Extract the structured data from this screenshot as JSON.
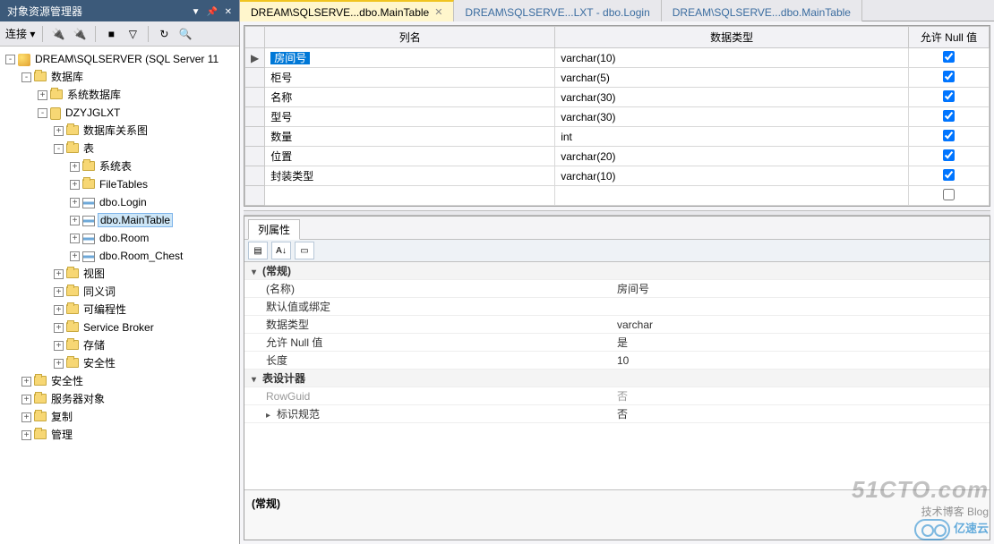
{
  "panel": {
    "title": "对象资源管理器",
    "connect_label": "连接 ▾"
  },
  "tree": [
    {
      "indent": 0,
      "exp": "-",
      "icon": "srv",
      "label": "DREAM\\SQLSERVER (SQL Server 11"
    },
    {
      "indent": 1,
      "exp": "-",
      "icon": "folder",
      "label": "数据库"
    },
    {
      "indent": 2,
      "exp": "+",
      "icon": "folder",
      "label": "系统数据库"
    },
    {
      "indent": 2,
      "exp": "-",
      "icon": "db",
      "label": "DZYJGLXT"
    },
    {
      "indent": 3,
      "exp": "+",
      "icon": "folder",
      "label": "数据库关系图"
    },
    {
      "indent": 3,
      "exp": "-",
      "icon": "folder",
      "label": "表"
    },
    {
      "indent": 4,
      "exp": "+",
      "icon": "folder",
      "label": "系统表"
    },
    {
      "indent": 4,
      "exp": "+",
      "icon": "folder",
      "label": "FileTables"
    },
    {
      "indent": 4,
      "exp": "+",
      "icon": "tbl",
      "label": "dbo.Login"
    },
    {
      "indent": 4,
      "exp": "+",
      "icon": "tbl",
      "label": "dbo.MainTable",
      "selected": true
    },
    {
      "indent": 4,
      "exp": "+",
      "icon": "tbl",
      "label": "dbo.Room"
    },
    {
      "indent": 4,
      "exp": "+",
      "icon": "tbl",
      "label": "dbo.Room_Chest"
    },
    {
      "indent": 3,
      "exp": "+",
      "icon": "folder",
      "label": "视图"
    },
    {
      "indent": 3,
      "exp": "+",
      "icon": "folder",
      "label": "同义词"
    },
    {
      "indent": 3,
      "exp": "+",
      "icon": "folder",
      "label": "可编程性"
    },
    {
      "indent": 3,
      "exp": "+",
      "icon": "folder",
      "label": "Service Broker"
    },
    {
      "indent": 3,
      "exp": "+",
      "icon": "folder",
      "label": "存储"
    },
    {
      "indent": 3,
      "exp": "+",
      "icon": "folder",
      "label": "安全性"
    },
    {
      "indent": 1,
      "exp": "+",
      "icon": "folder",
      "label": "安全性"
    },
    {
      "indent": 1,
      "exp": "+",
      "icon": "folder",
      "label": "服务器对象"
    },
    {
      "indent": 1,
      "exp": "+",
      "icon": "folder",
      "label": "复制"
    },
    {
      "indent": 1,
      "exp": "+",
      "icon": "folder",
      "label": "管理"
    }
  ],
  "tabs": [
    {
      "label": "DREAM\\SQLSERVE...dbo.MainTable",
      "active": true,
      "closable": true
    },
    {
      "label": "DREAM\\SQLSERVE...LXT - dbo.Login",
      "active": false
    },
    {
      "label": "DREAM\\SQLSERVE...dbo.MainTable",
      "active": false
    }
  ],
  "designer": {
    "headers": {
      "col": "列名",
      "type": "数据类型",
      "null": "允许 Null 值"
    },
    "rows": [
      {
        "name": "房间号",
        "type": "varchar(10)",
        "nullable": true,
        "current": true
      },
      {
        "name": "柜号",
        "type": "varchar(5)",
        "nullable": true
      },
      {
        "name": "名称",
        "type": "varchar(30)",
        "nullable": true
      },
      {
        "name": "型号",
        "type": "varchar(30)",
        "nullable": true
      },
      {
        "name": "数量",
        "type": "int",
        "nullable": true
      },
      {
        "name": "位置",
        "type": "varchar(20)",
        "nullable": true
      },
      {
        "name": "封装类型",
        "type": "varchar(10)",
        "nullable": true
      }
    ]
  },
  "props": {
    "tab_label": "列属性",
    "cat_general": "(常规)",
    "rows": [
      {
        "k": "(名称)",
        "v": "房间号"
      },
      {
        "k": "默认值或绑定",
        "v": ""
      },
      {
        "k": "数据类型",
        "v": "varchar"
      },
      {
        "k": "允许 Null 值",
        "v": "是"
      },
      {
        "k": "长度",
        "v": "10"
      }
    ],
    "cat_designer": "表设计器",
    "rows2": [
      {
        "k": "RowGuid",
        "v": "否",
        "disabled": true
      },
      {
        "k": "标识规范",
        "v": "否",
        "caret": true
      }
    ],
    "footer": "(常规)"
  },
  "watermark": {
    "big": "51CTO.com",
    "sm": "技术博客  Blog",
    "brand": "亿速云"
  }
}
